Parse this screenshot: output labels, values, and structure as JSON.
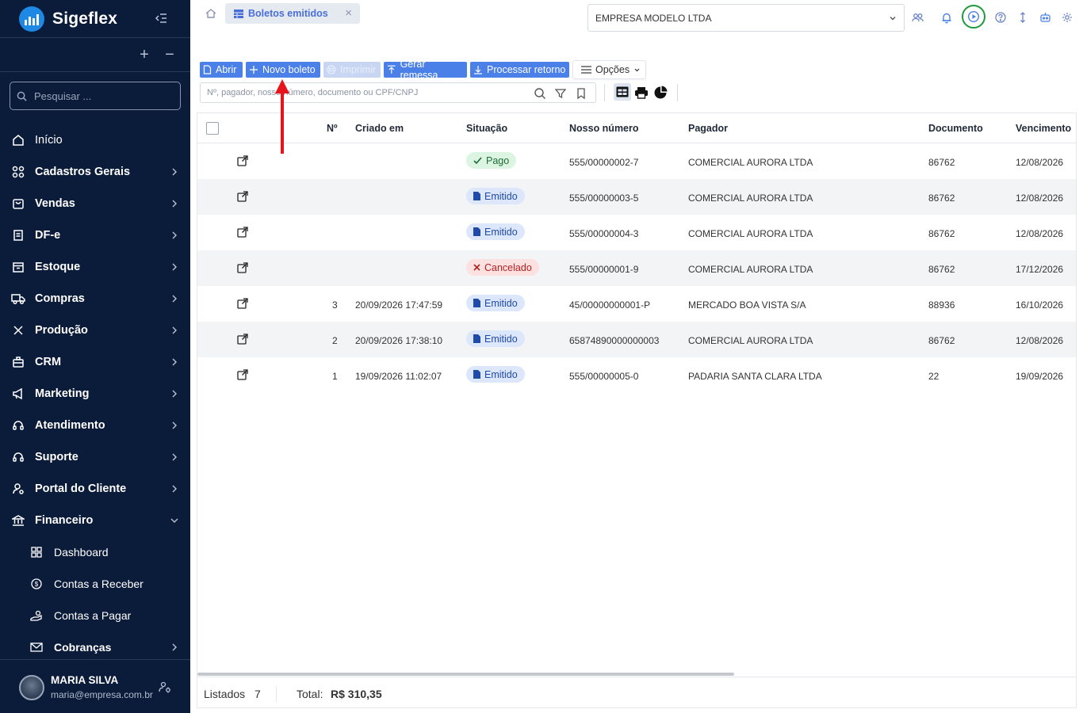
{
  "app": {
    "name": "Sigeflex"
  },
  "sidebar": {
    "search_placeholder": "Pesquisar ...",
    "items": [
      {
        "label": "Início",
        "icon": "home-icon"
      },
      {
        "label": "Cadastros Gerais",
        "icon": "grid-icon"
      },
      {
        "label": "Vendas",
        "icon": "shopping-bag-icon"
      },
      {
        "label": "DF-e",
        "icon": "document-icon"
      },
      {
        "label": "Estoque",
        "icon": "box-icon"
      },
      {
        "label": "Compras",
        "icon": "truck-icon"
      },
      {
        "label": "Produção",
        "icon": "tools-icon"
      },
      {
        "label": "CRM",
        "icon": "briefcase-icon"
      },
      {
        "label": "Marketing",
        "icon": "megaphone-icon"
      },
      {
        "label": "Atendimento",
        "icon": "headset-icon"
      },
      {
        "label": "Suporte",
        "icon": "support-icon"
      },
      {
        "label": "Portal do Cliente",
        "icon": "user-settings-icon"
      },
      {
        "label": "Financeiro",
        "icon": "bank-icon"
      }
    ],
    "subitems": [
      {
        "label": "Dashboard",
        "icon": "dashboard-icon"
      },
      {
        "label": "Contas a Receber",
        "icon": "coin-icon"
      },
      {
        "label": "Contas a Pagar",
        "icon": "hand-coins-icon"
      },
      {
        "label": "Cobranças",
        "icon": "mail-icon"
      }
    ]
  },
  "user": {
    "name": "MARIA SILVA",
    "email": "maria@empresa.com.br"
  },
  "header": {
    "tab_label": "Boletos emitidos",
    "company": "EMPRESA MODELO LTDA"
  },
  "toolbar": {
    "abrir": "Abrir",
    "novo_boleto": "Novo boleto",
    "imprimir": "Imprimir",
    "gerar_remessa": "Gerar remessa",
    "processar_retorno": "Processar retorno",
    "opcoes": "Opções"
  },
  "filter": {
    "placeholder": "Nº, pagador, nosso número, documento ou CPF/CNPJ"
  },
  "table": {
    "columns": [
      "Nº",
      "Criado em",
      "Situação",
      "Nosso número",
      "Pagador",
      "Documento",
      "Vencimento"
    ],
    "rows": [
      {
        "num": "",
        "criado": "",
        "situacao": "Pago",
        "status": "pago",
        "nosso": "555/00000002-7",
        "pagador": "COMERCIAL AURORA LTDA",
        "documento": "86762",
        "vencimento": "12/08/2026"
      },
      {
        "num": "",
        "criado": "",
        "situacao": "Emitido",
        "status": "emitido",
        "nosso": "555/00000003-5",
        "pagador": "COMERCIAL AURORA LTDA",
        "documento": "86762",
        "vencimento": "12/08/2026"
      },
      {
        "num": "",
        "criado": "",
        "situacao": "Emitido",
        "status": "emitido",
        "nosso": "555/00000004-3",
        "pagador": "COMERCIAL AURORA LTDA",
        "documento": "86762",
        "vencimento": "12/08/2026"
      },
      {
        "num": "",
        "criado": "",
        "situacao": "Cancelado",
        "status": "cancelado",
        "nosso": "555/00000001-9",
        "pagador": "COMERCIAL AURORA LTDA",
        "documento": "86762",
        "vencimento": "17/12/2026"
      },
      {
        "num": "3",
        "criado": "20/09/2026 17:47:59",
        "situacao": "Emitido",
        "status": "emitido",
        "nosso": "45/00000000001-P",
        "pagador": "MERCADO BOA VISTA S/A",
        "documento": "88936",
        "vencimento": "16/10/2026"
      },
      {
        "num": "2",
        "criado": "20/09/2026 17:38:10",
        "situacao": "Emitido",
        "status": "emitido",
        "nosso": "65874890000000003",
        "pagador": "COMERCIAL AURORA LTDA",
        "documento": "86762",
        "vencimento": "12/08/2026"
      },
      {
        "num": "1",
        "criado": "19/09/2026 11:02:07",
        "situacao": "Emitido",
        "status": "emitido",
        "nosso": "555/00000005-0",
        "pagador": "PADARIA SANTA CLARA LTDA",
        "documento": "22",
        "vencimento": "19/09/2026"
      }
    ]
  },
  "footer": {
    "listados_label": "Listados",
    "listados_count": "7",
    "total_label": "Total:",
    "total_value": "R$ 310,35"
  },
  "colors": {
    "sidebar": "#0b1b3a",
    "accent": "#4a80e8",
    "annotation": "#e8141c",
    "play_ring": "#1e9a3c"
  }
}
